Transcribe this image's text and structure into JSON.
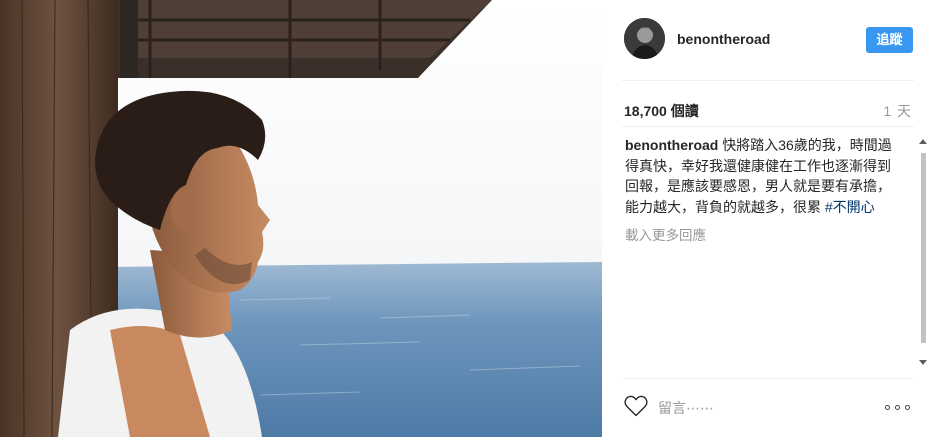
{
  "post": {
    "image_alt": "benontheroad post photo"
  },
  "header": {
    "username": "benontheroad",
    "follow_label": "追蹤"
  },
  "stats": {
    "views": "18,700 個讀",
    "time": "1 天"
  },
  "caption": {
    "username": "benontheroad",
    "text": " 快將踏入36歲的我，時間過得真快，幸好我還健康健在工作也逐漸得到回報，是應該要感恩，男人就是要有承擔，能力越大，背負的就越多，很累 ",
    "hashtag": "#不開心",
    "load_more": "載入更多回應"
  },
  "comment": {
    "placeholder": "留言⋯⋯"
  },
  "icons": {
    "like": "heart-outline-icon",
    "more": "more-options-icon"
  },
  "colors": {
    "follow_button": "#3897f0",
    "hashtag": "#003569",
    "muted_text": "#999999",
    "divider": "#efefef"
  }
}
